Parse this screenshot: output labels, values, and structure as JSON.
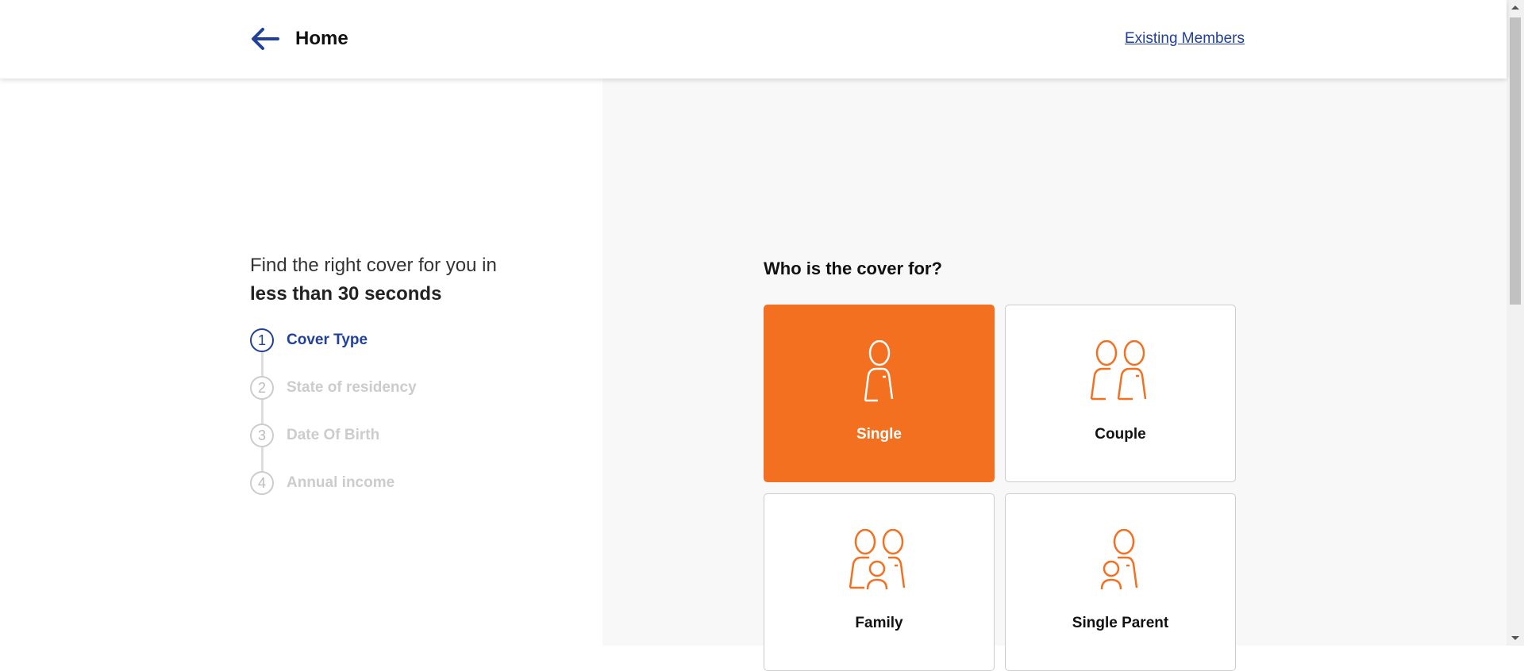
{
  "header": {
    "back_icon": "arrow-left-icon",
    "title": "Home",
    "existing_members": "Existing Members"
  },
  "intro": {
    "line1": "Find the right cover for you in",
    "line2": "less than 30 seconds"
  },
  "steps": [
    {
      "num": "1",
      "label": "Cover Type",
      "active": true
    },
    {
      "num": "2",
      "label": "State of residency",
      "active": false
    },
    {
      "num": "3",
      "label": "Date Of Birth",
      "active": false
    },
    {
      "num": "4",
      "label": "Annual income",
      "active": false
    }
  ],
  "question": "Who is the cover for?",
  "options": [
    {
      "label": "Single",
      "icon": "single-person-icon",
      "selected": true
    },
    {
      "label": "Couple",
      "icon": "couple-icon",
      "selected": false
    },
    {
      "label": "Family",
      "icon": "family-icon",
      "selected": false
    },
    {
      "label": "Single Parent",
      "icon": "single-parent-icon",
      "selected": false
    }
  ],
  "colors": {
    "accent": "#F37021",
    "primary": "#21409A"
  }
}
